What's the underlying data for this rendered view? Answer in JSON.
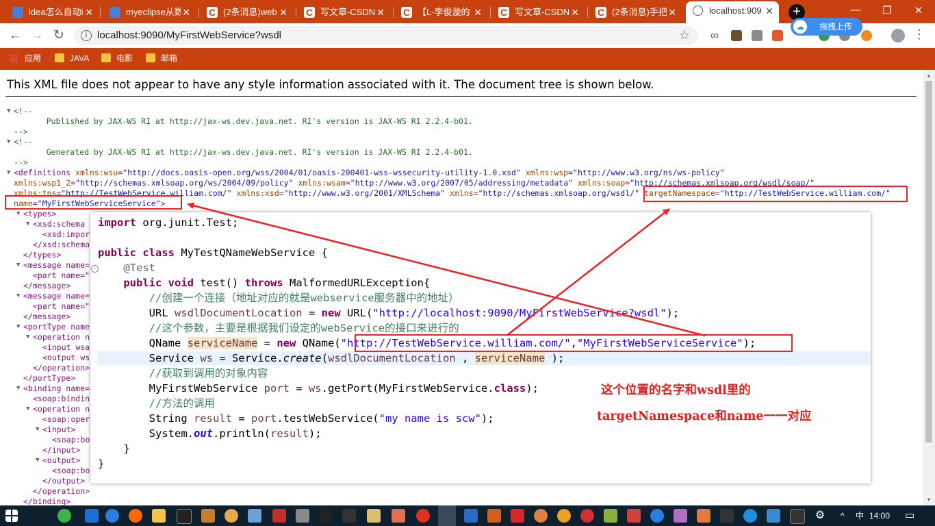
{
  "browser": {
    "tabs": [
      {
        "label": "idea怎么自动i",
        "icon": "blog-icon"
      },
      {
        "label": "myeclipse从数",
        "icon": "blog-icon"
      },
      {
        "label": "(2条消息)web",
        "icon": "csdn-icon"
      },
      {
        "label": "写文章-CSDN",
        "icon": "csdn-icon"
      },
      {
        "label": "【L-李俊漩的",
        "icon": "csdn-icon"
      },
      {
        "label": "写文章-CSDN",
        "icon": "csdn-icon"
      },
      {
        "label": "(2条消息)手把",
        "icon": "csdn-icon"
      },
      {
        "label": "localhost:909",
        "icon": "globe-icon",
        "active": true
      }
    ],
    "new_tab": "+",
    "url": "localhost:9090/MyFirstWebService?wsdl",
    "upload_button": "拖拽上传",
    "bookmarks": [
      "应用",
      "JAVA",
      "电影",
      "邮箱"
    ]
  },
  "page": {
    "notice": "This XML file does not appear to have any style information associated with it. The document tree is shown below.",
    "xml_lines": [
      "<!--",
      "    Published by JAX-WS RI at http://jax-ws.dev.java.net. RI's version is JAX-WS RI 2.2.4-b01.",
      "-->",
      "<!--",
      "    Generated by JAX-WS RI at http://jax-ws.dev.java.net. RI's version is JAX-WS RI 2.2.4-b01.",
      "-->",
      "<definitions xmlns:wsu=\"http://docs.oasis-open.org/wss/2004/01/oasis-200401-wss-wssecurity-utility-1.0.xsd\" xmlns:wsp=\"http://www.w3.org/ns/ws-policy\"",
      "xmlns:wsp1_2=\"http://schemas.xmlsoap.org/ws/2004/09/policy\" xmlns:wsam=\"http://www.w3.org/2007/05/addressing/metadata\" xmlns:soap=\"http://schemas.xmlsoap.org/wsdl/soap/\"",
      "xmlns:tns=\"http://TestWebService.william.com/\" xmlns:xsd=\"http://www.w3.org/2001/XMLSchema\" xmlns=\"http://schemas.xmlsoap.org/wsdl/\" targetNamespace=\"http://TestWebService.william.com/\"",
      "name=\"MyFirstWebServiceService\">",
      "<types>",
      "<xsd:schema",
      "<xsd:import",
      "</xsd:schema",
      "</types>",
      "<message name=",
      "<part name=\"",
      "</message>",
      "<message name=",
      "<part name=\"",
      "</message>",
      "<portType name",
      "<operation n",
      "<input wsa",
      "<output ws",
      "</operation>",
      "</portType>",
      "<binding name=",
      "<soap:binding",
      "<operation n",
      "<soap:opera",
      "<input>",
      "<soap:boo",
      "</input>",
      "<output>",
      "<soap:boo",
      "</output>",
      "</operation>",
      "</binding>"
    ]
  },
  "code": {
    "lines": [
      "import org.junit.Test;",
      "",
      "public class MyTestQNameWebService {",
      "    @Test",
      "    public void test() throws MalformedURLException{",
      "        //创建一个连接（地址对应的就是webservice服务器中的地址）",
      "        URL wsdlDocumentLocation = new URL(\"http://localhost:9090/MyFirstWebService?wsdl\");",
      "        //这个参数，主要是根据我们设定的webService的接口来进行的",
      "        QName serviceName = new QName(\"http://TestWebService.william.com/\",\"MyFirstWebServiceService\");",
      "        Service ws = Service.create(wsdlDocumentLocation , serviceName );",
      "        //获取到调用的对象内容",
      "        MyFirstWebService port = ws.getPort(MyFirstWebService.class);",
      "        //方法的调用",
      "        String result = port.testWebService(\"my name is scw\");",
      "        System.out.println(result);",
      "    }",
      "}"
    ],
    "note_line1": "这个位置的名字和wsdl里的",
    "note_line2": "targetNamespace和name一一对应"
  },
  "taskbar": {
    "ime": "中",
    "time": "14:00"
  },
  "colors": {
    "chrome": "#c8410f",
    "annotation": "#e22222"
  }
}
